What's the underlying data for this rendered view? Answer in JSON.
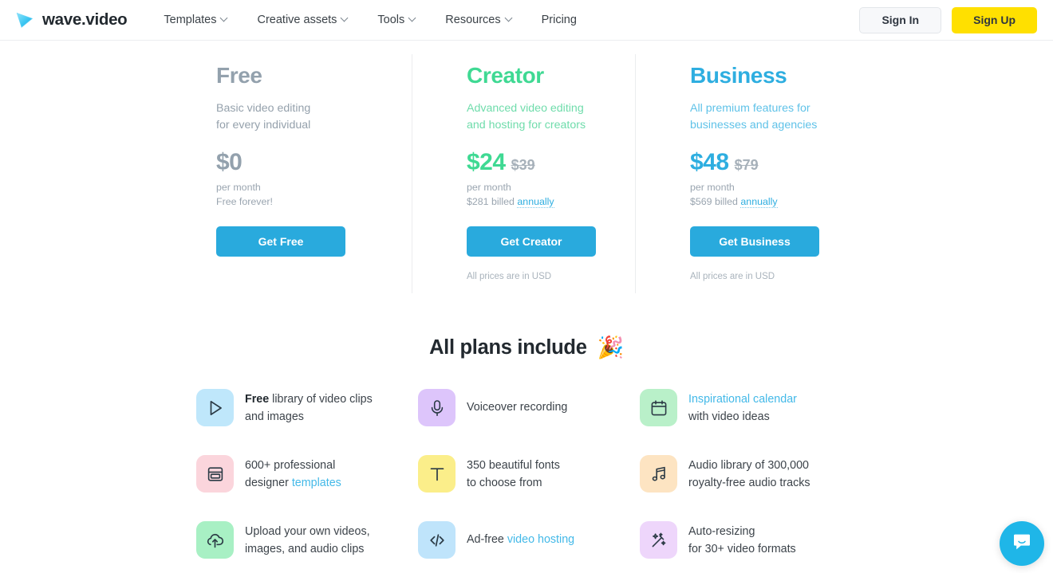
{
  "header": {
    "logo_text": "wave.video",
    "logo_icon": "wave-play-triangle-icon",
    "nav": [
      {
        "label": "Templates",
        "has_chevron": true
      },
      {
        "label": "Creative assets",
        "has_chevron": true
      },
      {
        "label": "Tools",
        "has_chevron": true
      },
      {
        "label": "Resources",
        "has_chevron": true
      },
      {
        "label": "Pricing",
        "has_chevron": false
      }
    ],
    "sign_in_label": "Sign In",
    "sign_up_label": "Sign Up"
  },
  "pricing": {
    "plans": [
      {
        "name": "Free",
        "color": "#93a1ad",
        "desc_line1": "Basic video editing",
        "desc_line2": "for every individual",
        "price": "$0",
        "price_old": "",
        "per": "per month",
        "billed_prefix": "Free forever!",
        "billed_link": "",
        "cta": "Get Free",
        "usd_note": ""
      },
      {
        "name": "Creator",
        "color": "#3fd993",
        "desc_line1": "Advanced video editing",
        "desc_line2": "and hosting for creators",
        "price": "$24",
        "price_old": "$39",
        "per": "per month",
        "billed_prefix": "$281 billed",
        "billed_link": "annually",
        "cta": "Get Creator",
        "usd_note": "All prices are in USD"
      },
      {
        "name": "Business",
        "color": "#2eaee0",
        "desc_line1": "All premium features for",
        "desc_line2": "businesses and agencies",
        "price": "$48",
        "price_old": "$79",
        "per": "per month",
        "billed_prefix": "$569 billed",
        "billed_link": "annually",
        "cta": "Get Business",
        "usd_note": "All prices are in USD"
      }
    ]
  },
  "include": {
    "heading": "All plans include",
    "emoji": "🎉",
    "features": [
      {
        "icon": "play-button-icon",
        "bg": "#bfe7fb",
        "stroke": "#2b3a45",
        "bold": "Free",
        "line1_rest": " library of video clips",
        "line2": "and images",
        "link": "",
        "link_tail": ""
      },
      {
        "icon": "microphone-icon",
        "bg": "#ddc5fb",
        "stroke": "#2b3a45",
        "bold": "",
        "line1_rest": "Voiceover recording",
        "line2": "",
        "link": "",
        "link_tail": ""
      },
      {
        "icon": "calendar-icon",
        "bg": "#b9f0c9",
        "stroke": "#2b3a45",
        "bold": "",
        "line1_rest": "",
        "line2": "with video ideas",
        "link": "Inspirational calendar",
        "link_tail": ""
      },
      {
        "icon": "template-layout-icon",
        "bg": "#fbd5dc",
        "stroke": "#2b3a45",
        "bold": "",
        "line1_rest": "600+ professional",
        "line2": "designer ",
        "link": "templates",
        "link_tail": ""
      },
      {
        "icon": "text-tool-icon",
        "bg": "#fbee8a",
        "stroke": "#2b3a45",
        "bold": "",
        "line1_rest": "350 beautiful fonts",
        "line2": "to choose from",
        "link": "",
        "link_tail": ""
      },
      {
        "icon": "music-note-icon",
        "bg": "#fde4c2",
        "stroke": "#2b3a45",
        "bold": "",
        "line1_rest": "Audio library of 300,000",
        "line2": "royalty-free audio tracks",
        "link": "",
        "link_tail": ""
      },
      {
        "icon": "cloud-upload-icon",
        "bg": "#a8f0c4",
        "stroke": "#2b3a45",
        "bold": "",
        "line1_rest": "Upload your own videos,",
        "line2": "images, and audio clips",
        "link": "",
        "link_tail": ""
      },
      {
        "icon": "code-embed-icon",
        "bg": "#bfe4fb",
        "stroke": "#2b3a45",
        "bold": "",
        "line1_rest": "Ad-free ",
        "line2": "",
        "link": "video hosting",
        "link_tail": ""
      },
      {
        "icon": "magic-wand-icon",
        "bg": "#eed6fb",
        "stroke": "#2b3a45",
        "bold": "",
        "line1_rest": "Auto-resizing",
        "line2": "for 30+ video formats",
        "link": "",
        "link_tail": ""
      }
    ]
  },
  "chat": {
    "icon": "chat-bubble-icon",
    "color": "#1fb6e8"
  }
}
